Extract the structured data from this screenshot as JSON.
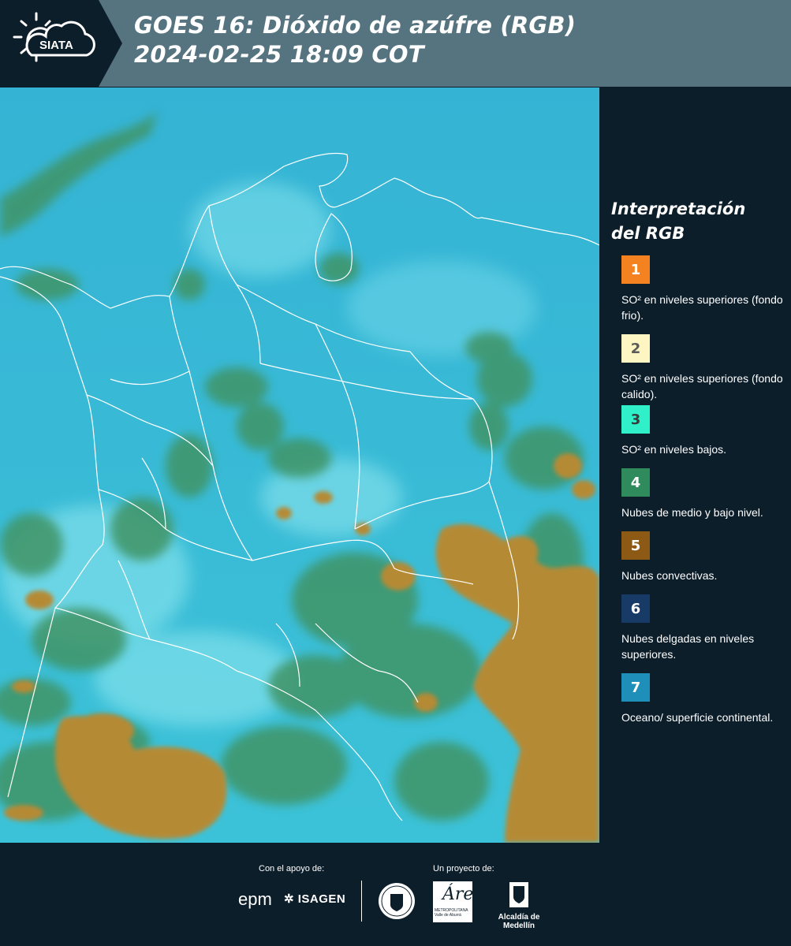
{
  "header": {
    "logo_text": "SIATA",
    "title_line1": "GOES 16: Dióxido de azúfre (RGB)",
    "title_line2": " 2024-02-25 18:09 COT"
  },
  "legend": {
    "title_line1": "Interpretación",
    "title_line2": "del RGB",
    "items": [
      {
        "num": "1",
        "label": "SO² en niveles superiores (fondo frio).",
        "color": "#f58220",
        "num_color": "#ffffff"
      },
      {
        "num": "2",
        "label": "SO² en niveles superiores (fondo calido).",
        "color": "#fdf6c3",
        "num_color": "#5a5a5a"
      },
      {
        "num": "3",
        "label": "SO² en niveles bajos.",
        "color": "#2ff0c8",
        "num_color": "#3a3a3a"
      },
      {
        "num": "4",
        "label": "Nubes de medio y bajo nivel.",
        "color": "#2f8a5c",
        "num_color": "#ffffff"
      },
      {
        "num": "5",
        "label": "Nubes convectivas.",
        "color": "#8c5a14",
        "num_color": "#ffffff"
      },
      {
        "num": "6",
        "label": "Nubes delgadas en niveles superiores.",
        "color": "#173a66",
        "num_color": "#ffffff"
      },
      {
        "num": "7",
        "label": "Oceano/ superficie continental.",
        "color": "#1e8fb8",
        "num_color": "#ffffff"
      }
    ]
  },
  "footer": {
    "support_label": "Con el apoyo de:",
    "project_label": "Un proyecto de:",
    "sponsor1": "epm",
    "sponsor2": "ISAGEN",
    "partner_area": "Área",
    "partner_area_sub": "METROPOLITANA Valle de Aburrá",
    "partner_alcaldia": "Alcaldía de Medellín"
  },
  "colors": {
    "header_bg": "#557480",
    "page_bg": "#0d1e2b",
    "ocean": "#3ab6d2",
    "low_cloud": "#3f9466",
    "convective": "#b58a35"
  }
}
